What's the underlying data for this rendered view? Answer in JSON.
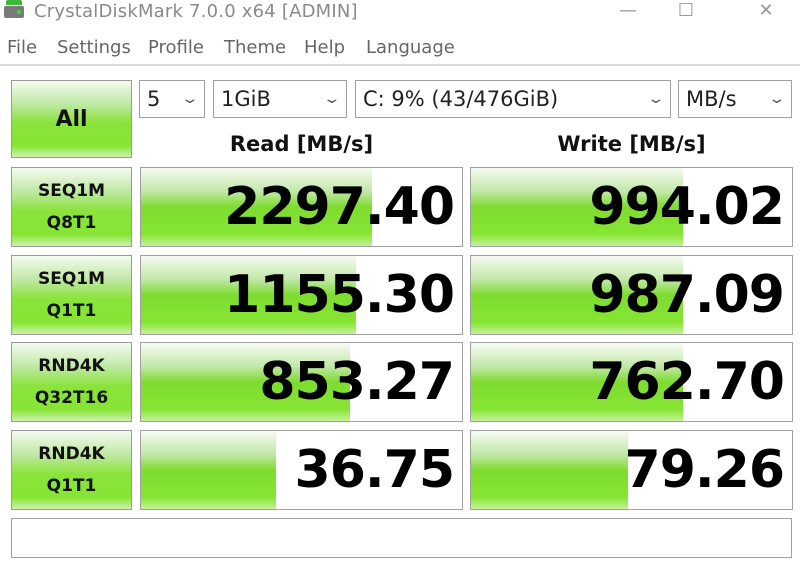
{
  "window": {
    "title": "CrystalDiskMark 7.0.0 x64 [ADMIN]",
    "controls": {
      "minimize": "—",
      "maximize": "☐",
      "close": "✕"
    }
  },
  "menu": [
    "File",
    "Settings",
    "Profile",
    "Theme",
    "Help",
    "Language"
  ],
  "toolbar": {
    "all_label": "All",
    "count": "5",
    "size": "1GiB",
    "drive": "C: 9% (43/476GiB)",
    "unit": "MB/s",
    "chevron": "⌄"
  },
  "headers": {
    "read": "Read [MB/s]",
    "write": "Write [MB/s]"
  },
  "tests": [
    {
      "line1": "SEQ1M",
      "line2": "Q8T1",
      "read": "2297.40",
      "write": "994.02",
      "read_fill": 0.72,
      "write_fill": 0.66
    },
    {
      "line1": "SEQ1M",
      "line2": "Q1T1",
      "read": "1155.30",
      "write": "987.09",
      "read_fill": 0.67,
      "write_fill": 0.66
    },
    {
      "line1": "RND4K",
      "line2": "Q32T16",
      "read": "853.27",
      "write": "762.70",
      "read_fill": 0.65,
      "write_fill": 0.66
    },
    {
      "line1": "RND4K",
      "line2": "Q1T1",
      "read": "36.75",
      "write": "79.26",
      "read_fill": 0.42,
      "write_fill": 0.49
    }
  ],
  "status": ""
}
